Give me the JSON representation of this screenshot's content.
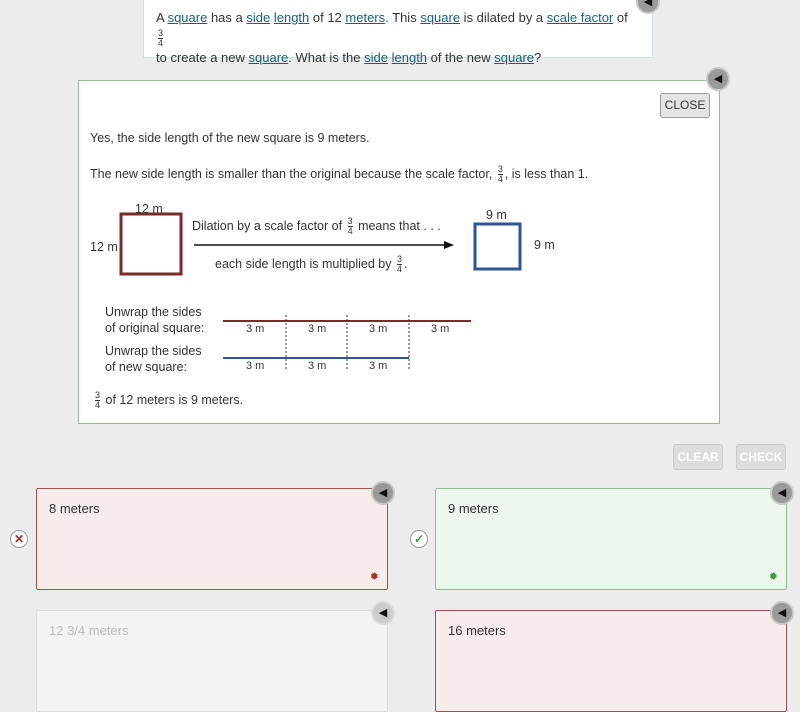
{
  "question": {
    "segments": [
      {
        "t": "A "
      },
      {
        "t": "square",
        "link": true
      },
      {
        "t": " has a "
      },
      {
        "t": "side",
        "link": true
      },
      {
        "t": " "
      },
      {
        "t": "length",
        "link": true
      },
      {
        "t": " of 12 "
      },
      {
        "t": "meters",
        "link": true
      },
      {
        "t": ". This "
      },
      {
        "t": "square",
        "link": true
      },
      {
        "t": " is dilated by a "
      },
      {
        "t": "scale factor",
        "link": true
      },
      {
        "t": " of "
      },
      {
        "frac": [
          "3",
          "4"
        ]
      },
      {
        "br": true
      },
      {
        "t": "to create a new "
      },
      {
        "t": "square",
        "link": true
      },
      {
        "t": ". What is the "
      },
      {
        "t": "side",
        "link": true
      },
      {
        "t": " "
      },
      {
        "t": "length",
        "link": true
      },
      {
        "t": " of the new "
      },
      {
        "t": "square",
        "link": true
      },
      {
        "t": "?"
      }
    ]
  },
  "feedback": {
    "close_label": "CLOSE",
    "line1": "Yes, the side length of the new square is 9 meters.",
    "line2a": "The new side length is smaller than the original because the scale factor,",
    "line2b": ", is less than 1.",
    "frac_n": "3",
    "frac_d": "4",
    "orig_top": "12 m",
    "orig_side": "12 m",
    "new_top": "9 m",
    "new_side": "9 m",
    "arrow_top_a": "Dilation by a scale factor of",
    "arrow_top_b": "means that  . . .",
    "arrow_bottom_a": "each side length is multiplied by",
    "arrow_bottom_b": ".",
    "unwrap_orig": [
      "Unwrap the sides",
      "of original square:"
    ],
    "unwrap_new": [
      "Unwrap the sides",
      "of new square:"
    ],
    "seg_label": "3 m",
    "conclusion": "of 12 meters is 9 meters.",
    "colors": {
      "original": "#7a2a2a",
      "new": "#2f5496"
    }
  },
  "buttons": {
    "clear": "CLEAR",
    "check": "CHECK"
  },
  "answers": [
    {
      "text": "8 meters",
      "status": "incorrect"
    },
    {
      "text": "9 meters",
      "status": "correct"
    },
    {
      "text": "12 3/4 meters",
      "status": "disabled"
    },
    {
      "text": "16 meters",
      "status": "incorrect"
    }
  ],
  "icons": {
    "speaker": "speaker-icon",
    "wrong": "x-icon",
    "right": "check-icon",
    "hint": "lightbulb-icon"
  }
}
